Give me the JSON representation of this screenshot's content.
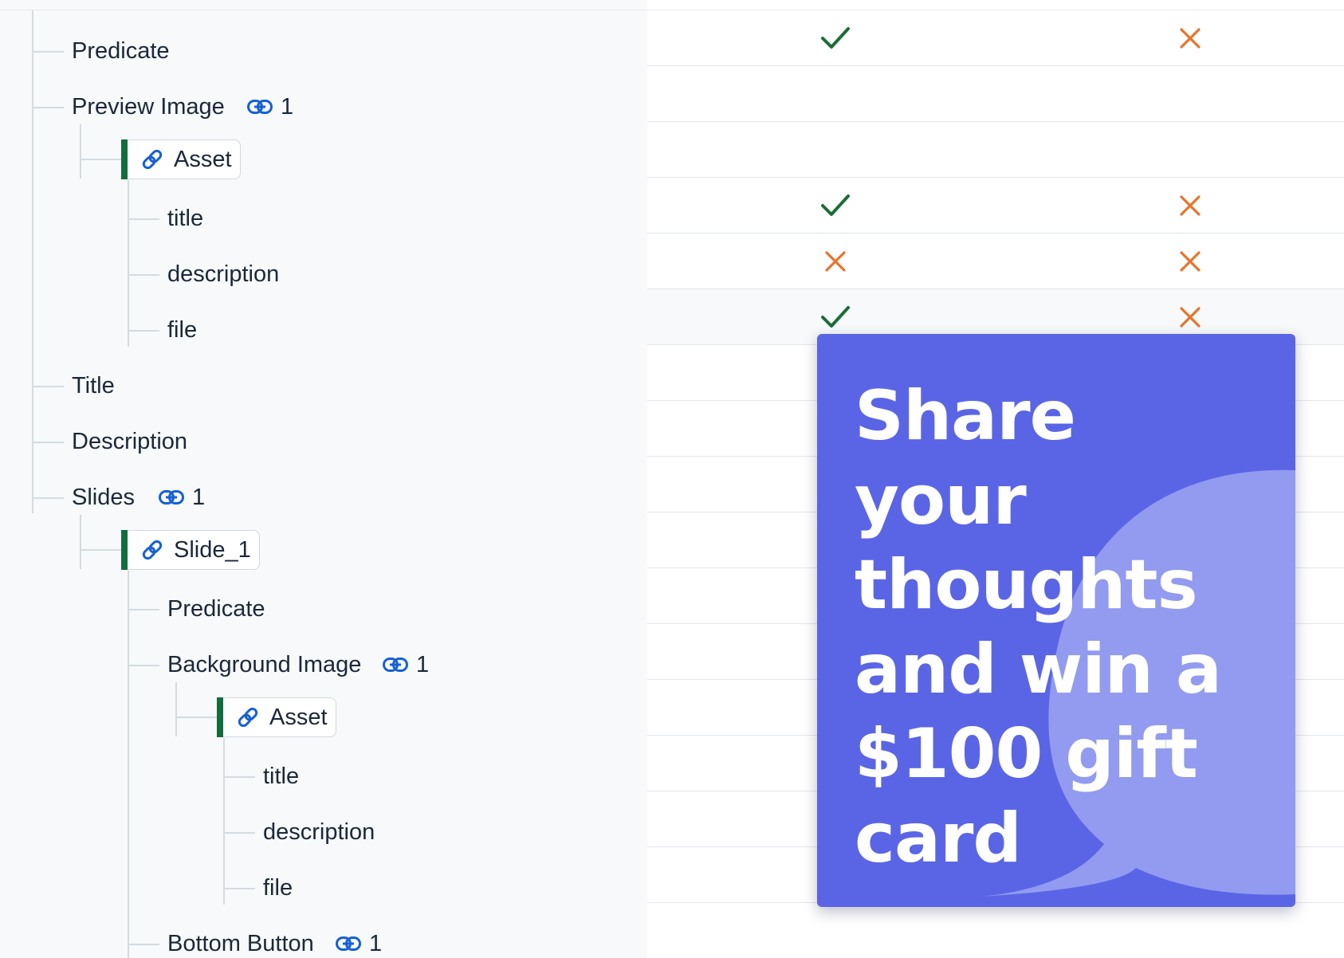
{
  "tree": {
    "predicate_label": "Predicate",
    "preview_image": {
      "label": "Preview Image",
      "link_count": "1"
    },
    "asset_ref": {
      "title": "Asset",
      "fields": [
        "title",
        "description",
        "file"
      ]
    },
    "title_label": "Title",
    "description_label": "Description",
    "slides": {
      "label": "Slides",
      "link_count": "1"
    },
    "slide_ref": {
      "title": "Slide_1"
    },
    "slide_children": {
      "predicate_label": "Predicate",
      "background_image": {
        "label": "Background Image",
        "link_count": "1"
      },
      "asset_ref": {
        "title": "Asset",
        "fields": [
          "title",
          "description",
          "file"
        ]
      },
      "bottom_button": {
        "label": "Bottom Button",
        "link_count": "1"
      }
    }
  },
  "table": {
    "rows": [
      {
        "col1": "check",
        "col2": "cross"
      },
      {
        "col1": "",
        "col2": ""
      },
      {
        "col1": "",
        "col2": ""
      },
      {
        "col1": "check",
        "col2": "cross"
      },
      {
        "col1": "cross",
        "col2": "cross"
      },
      {
        "col1": "check",
        "col2": "cross"
      },
      {
        "col1": "",
        "col2": ""
      },
      {
        "col1": "",
        "col2": ""
      },
      {
        "col1": "",
        "col2": ""
      },
      {
        "col1": "",
        "col2": ""
      },
      {
        "col1": "",
        "col2": ""
      },
      {
        "col1": "",
        "col2": ""
      },
      {
        "col1": "",
        "col2": ""
      },
      {
        "col1": "",
        "col2": ""
      },
      {
        "col1": "",
        "col2": ""
      },
      {
        "col1": "",
        "col2": ""
      }
    ]
  },
  "promo": {
    "text": "Share your thoughts and win a $100 gift card"
  },
  "colors": {
    "check": "#1a6e35",
    "cross": "#e8742a",
    "link_icon": "#1560d4",
    "ref_accent": "#116d3b",
    "promo_bg": "#5a65e6",
    "promo_bubble": "#929bf0"
  }
}
